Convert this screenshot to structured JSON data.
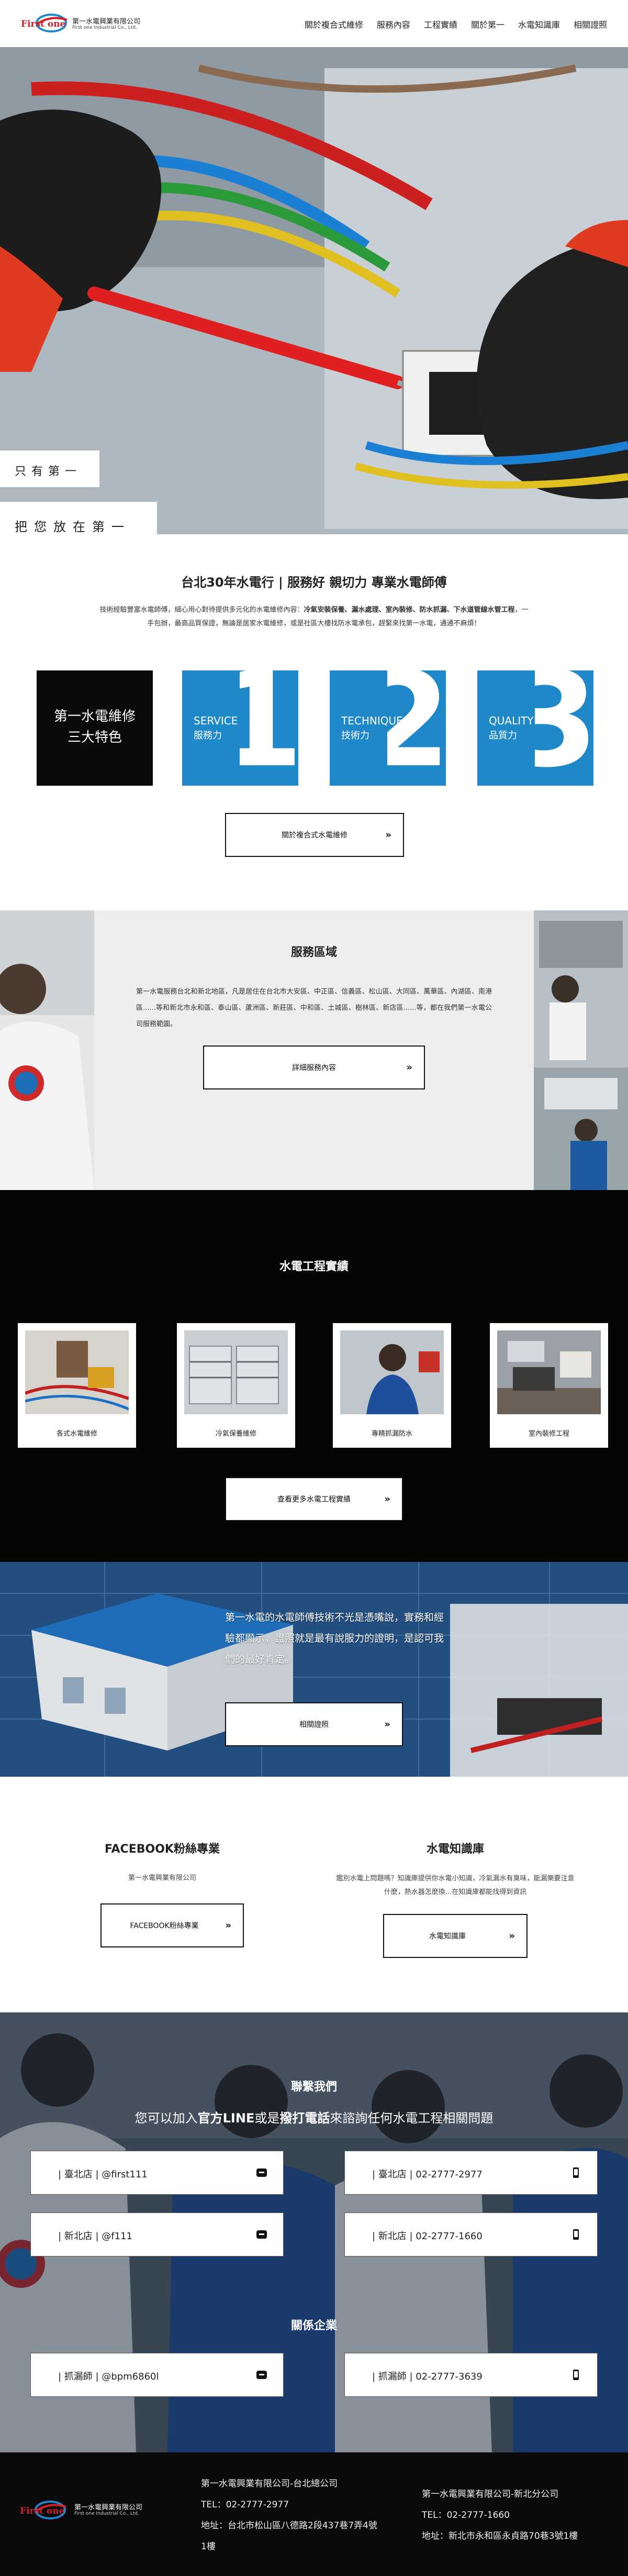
{
  "brand": {
    "logo_word": "First one",
    "name_zh": "第一水電興業有限公司",
    "name_en": "First one Industrial Co., Ltd."
  },
  "nav": [
    "關於複合式維修",
    "服務內容",
    "工程實績",
    "關於第一",
    "水電知識庫",
    "相關證照"
  ],
  "hero": {
    "slogan_line1": "只有第一",
    "slogan_line2": "把您放在第一"
  },
  "intro": {
    "title": "台北30年水電行 | 服務好 親切力 專業水電師傅",
    "para_a": "技術經驗豐富水電師傅，細心用心對待提供多元化的水電維修內容：",
    "para_highlight": "冷氣安裝保養、漏水處理、室內裝修、防水抓漏、下水道管線水管工程",
    "para_b": "，一",
    "para_line2": "手包辦，最高品質保證，無論是居家水電維修，或是社區大樓找防水電承包，趕緊來找第一水電，通通不麻煩！"
  },
  "features": {
    "black_line1": "第一水電維修",
    "black_line2": "三大特色",
    "items": [
      {
        "num": "1",
        "en": "SERVICE",
        "zh": "服務力"
      },
      {
        "num": "2",
        "en": "TECHNIQUE",
        "zh": "技術力"
      },
      {
        "num": "3",
        "en": "QUALITY",
        "zh": "品質力"
      }
    ],
    "button_label": "關於複合式水電維修"
  },
  "service_area": {
    "title": "服務區域",
    "text": "第一水電服務台北和新北地區，凡是居住在台北市大安區、中正區、信義區、松山區、大同區、萬華區、內湖區、南港區......等和新北市永和區、泰山區、蘆洲區、新莊區、中和區、土城區、樹林區、新店區......等，都在我們第一水電公司服務範圍。",
    "button_label": "詳細服務內容"
  },
  "projects": {
    "title": "水電工程實績",
    "cards": [
      {
        "caption": "各式水電維修"
      },
      {
        "caption": "冷氣保養維修"
      },
      {
        "caption": "專精抓漏防水"
      },
      {
        "caption": "室內裝修工程"
      }
    ],
    "button_label": "查看更多水電工程實績"
  },
  "license": {
    "text": "第一水電的水電師傅技術不光是憑嘴說，實務和經驗都顯示，證照就是最有說服力的證明，是認可我們的最好肯定。",
    "button_label": "相關證照"
  },
  "facebook": {
    "title": "FACEBOOK粉絲專業",
    "sub": "第一水電興業有限公司",
    "button_label": "FACEBOOK粉絲專業"
  },
  "knowledge": {
    "title": "水電知識庫",
    "sub_line1": "鑑別水電上問題嗎？知識庫提供你水電小知識，冷氣漏水有臭味，能漏樂要注意",
    "sub_line2": "什麼，熱水器怎麼換...在知識庫都能找得到資訊",
    "button_label": "水電知識庫"
  },
  "contact": {
    "title": "聯繫我們",
    "sub_pre": "您可以加入",
    "sub_b1": "官方LINE",
    "sub_mid": "或是",
    "sub_b2": "撥打電話",
    "sub_post": "來諮詢任何水電工程相關問題",
    "boxes": [
      {
        "text": "| 臺北店 | @first111",
        "icon": "line-icon"
      },
      {
        "text": "| 臺北店 | 02-2777-2977",
        "icon": "phone-icon"
      },
      {
        "text": "| 新北店 | @f111",
        "icon": "line-icon"
      },
      {
        "text": "| 新北店 | 02-2777-1660",
        "icon": "phone-icon"
      }
    ],
    "title2": "關係企業",
    "boxes2": [
      {
        "text": "| 抓漏師 | @bpm6860l",
        "icon": "line-icon"
      },
      {
        "text": "| 抓漏師 | 02-2777-3639",
        "icon": "phone-icon"
      }
    ]
  },
  "footer": {
    "col1": {
      "name": "第一水電興業有限公司-台北總公司",
      "tel": "TEL：02-2777-2977",
      "addr1": "地址：台北市松山區八德路2段437巷7弄4號",
      "addr2": "1樓"
    },
    "col2": {
      "name": "第一水電興業有限公司-新北分公司",
      "tel": "TEL：02-2777-1660",
      "addr": "地址：新北市永和區永貞路70巷3號1樓"
    }
  },
  "colors": {
    "accent_blue": "#1e88c8",
    "logo_red": "#d0202a",
    "dark": "#0a0a0a"
  }
}
